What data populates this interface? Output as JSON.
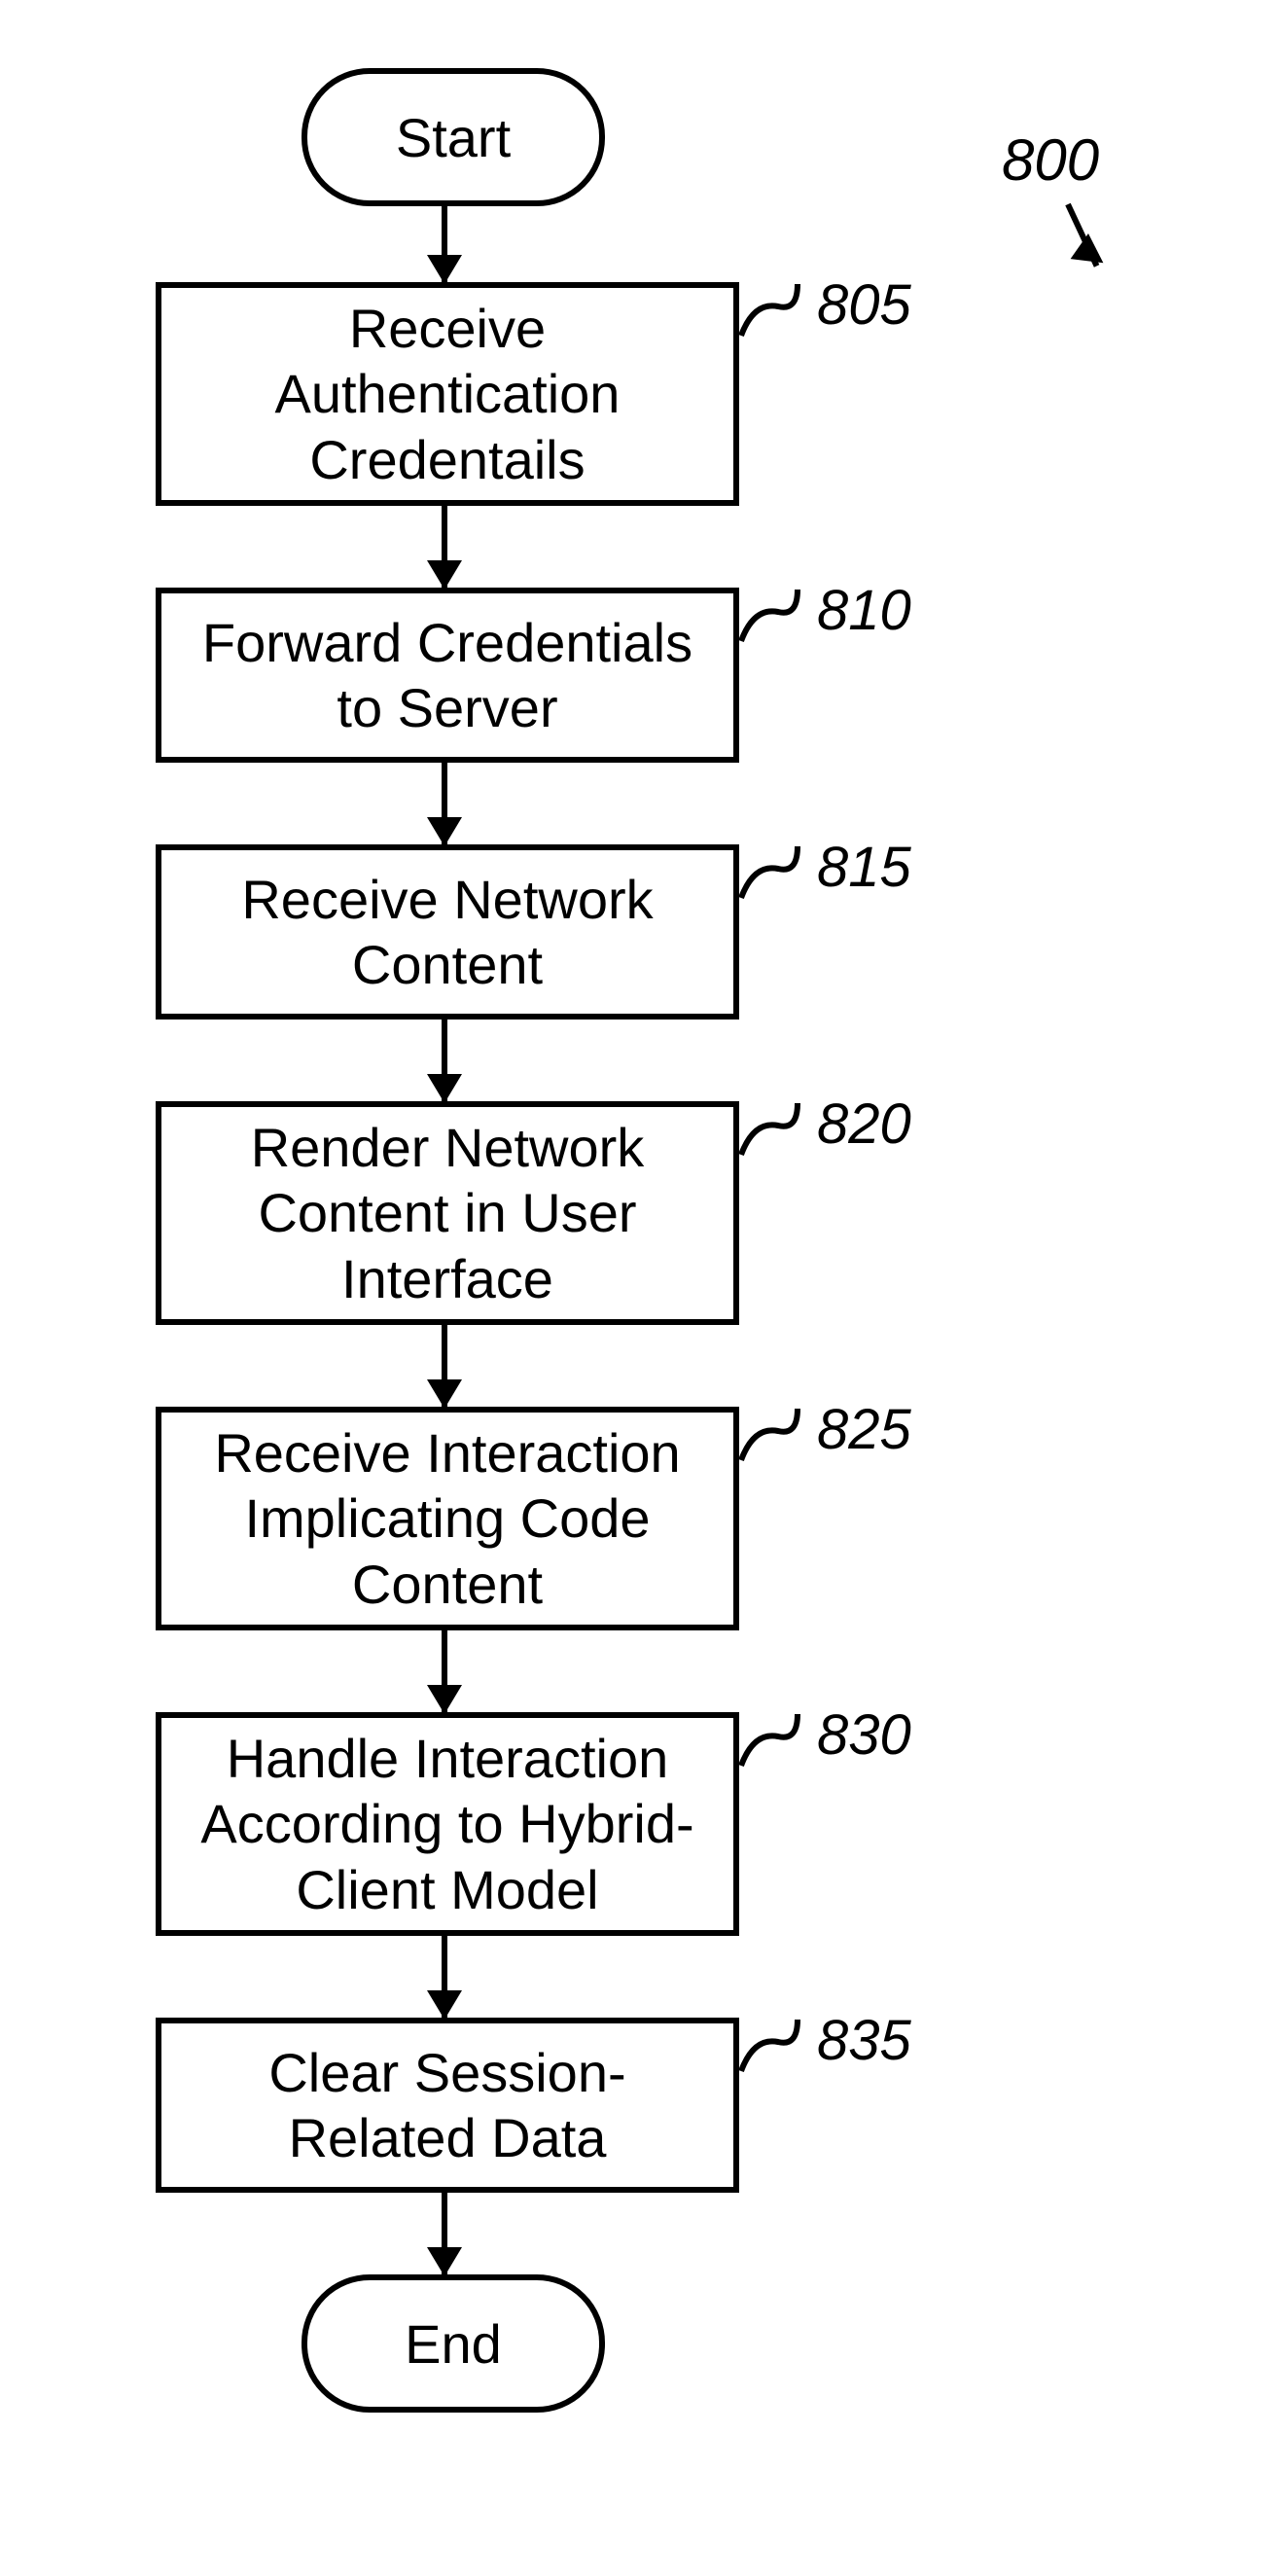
{
  "figure": {
    "label": "800"
  },
  "terminators": {
    "start": "Start",
    "end": "End"
  },
  "steps": [
    {
      "ref": "805",
      "text": "Receive Authentication Credentails"
    },
    {
      "ref": "810",
      "text": "Forward Credentials to Server"
    },
    {
      "ref": "815",
      "text": "Receive Network Content"
    },
    {
      "ref": "820",
      "text": "Render Network Content in User Interface"
    },
    {
      "ref": "825",
      "text": "Receive Interaction Implicating Code Content"
    },
    {
      "ref": "830",
      "text": "Handle Interaction According to Hybrid-Client Model"
    },
    {
      "ref": "835",
      "text": "Clear Session-Related Data"
    }
  ]
}
